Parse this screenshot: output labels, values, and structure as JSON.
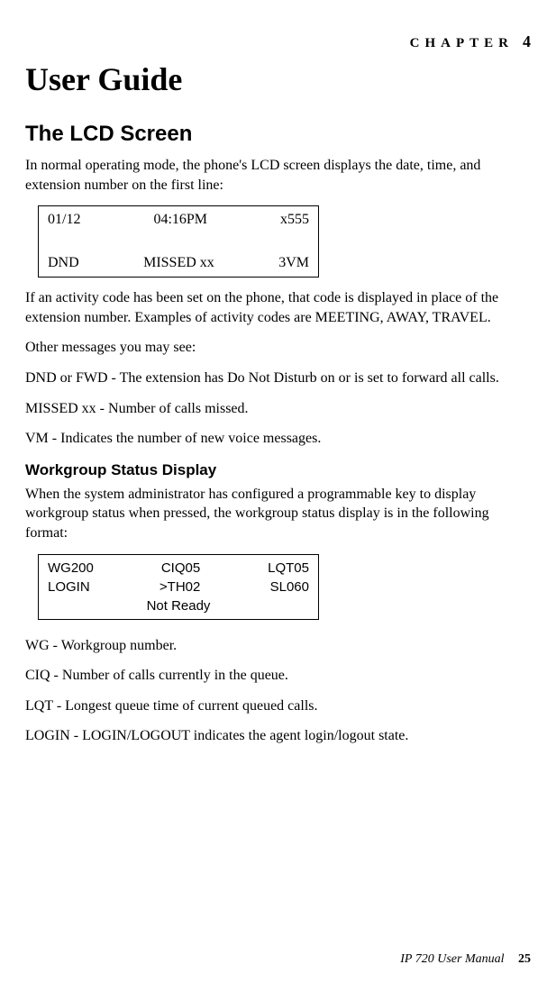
{
  "chapter": {
    "label": "CHAPTER",
    "number": "4"
  },
  "title": "User Guide",
  "section1": {
    "heading": "The LCD Screen",
    "intro": "In normal operating mode, the phone's LCD screen displays the date, time, and extension number on the first line:",
    "lcd": {
      "row1": {
        "a": "01/12",
        "b": "04:16PM",
        "c": "x555"
      },
      "row2": {
        "a": "DND",
        "b": "MISSED xx",
        "c": "3VM"
      }
    },
    "p_activity": "If an activity code has been set on the phone, that code is displayed in place of the extension number. Examples of activity codes are MEETING, AWAY, TRAVEL.",
    "p_other": "Other messages you may see:",
    "p_dnd": "DND or FWD - The extension has Do Not Disturb on or is set to forward all calls.",
    "p_missed": "MISSED xx - Number of calls missed.",
    "p_vm": "VM - Indicates the number of new voice messages."
  },
  "section2": {
    "heading": "Workgroup Status Display",
    "intro": "When the system administrator has configured a programmable key to display workgroup status when pressed, the workgroup status display is in the following format:",
    "wg": {
      "row1": {
        "a": "WG200",
        "b": "CIQ05",
        "c": "LQT05"
      },
      "row2": {
        "a": "LOGIN",
        "b": ">TH02",
        "c": "SL060"
      },
      "row3": "Not Ready"
    },
    "p_wg": "WG - Workgroup number.",
    "p_ciq": "CIQ - Number of calls currently in the queue.",
    "p_lqt": "LQT - Longest queue time of current queued calls.",
    "p_login": "LOGIN - LOGIN/LOGOUT indicates the agent login/logout state."
  },
  "footer": {
    "doc": "IP 720 User Manual",
    "page": "25"
  }
}
